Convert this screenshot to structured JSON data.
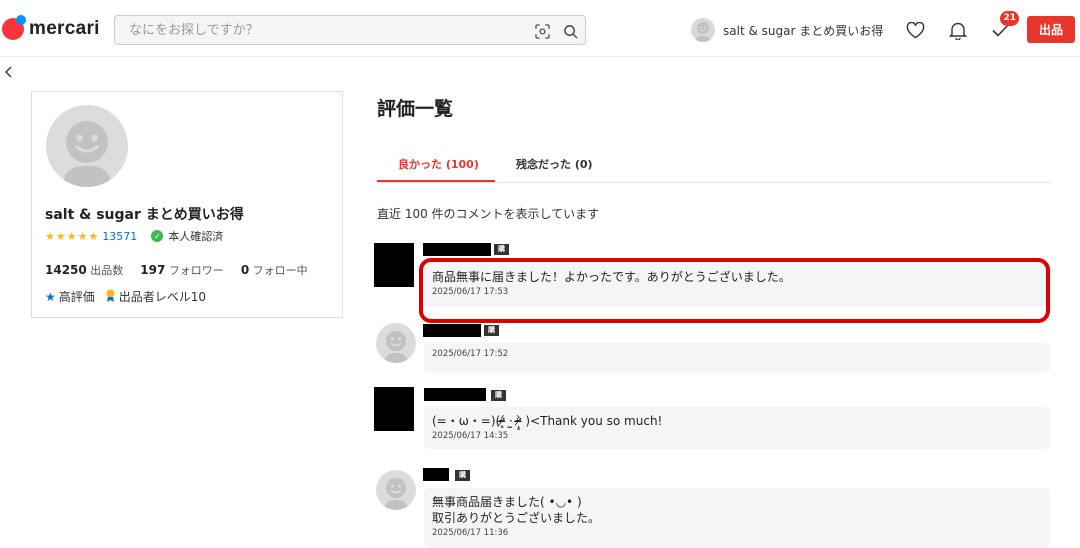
{
  "header": {
    "logo_text": "mercari",
    "search_placeholder": "なにをお探しですか？",
    "user_name": "salt & sugar まとめ買いお得",
    "todo_count": "21",
    "sell_label": "出品"
  },
  "profile": {
    "name": "salt & sugar まとめ買いお得",
    "stars": "★★★★★",
    "review_count": "13571",
    "verified_label": "本人確認済",
    "listings_count": "14250",
    "listings_label": "出品数",
    "followers_count": "197",
    "followers_label": "フォロワー",
    "following_count": "0",
    "following_label": "フォロー中",
    "badge_high_rating": "高評価",
    "badge_seller_level": "出品者レベル10"
  },
  "main": {
    "title": "評価一覧",
    "tabs": [
      {
        "label": "良かった (100)",
        "active": true
      },
      {
        "label": "残念だった (0)",
        "active": false
      }
    ],
    "summary": "直近 100 件のコメントを表示しています",
    "buyer_tag": "購入者",
    "reviews": [
      {
        "text": "商品無事に届きました！よかったです。ありがとうございました。",
        "date": "2025/06/17 17:53"
      },
      {
        "text": "",
        "date": "2025/06/17 17:52"
      },
      {
        "text": "(=・ω・=)(ᵒ̴̶̷̥́ ·̫ ᵒ̴̶̷̣̥̀ )<Thank you so much!",
        "date": "2025/06/17 14:35"
      },
      {
        "text": "無事商品届きました( •◡• )",
        "text2": "取引ありがとうございました。",
        "date": "2025/06/17 11:36"
      }
    ]
  },
  "colors": {
    "accent": "#ea352d",
    "link": "#0073cc",
    "star": "#ffb818",
    "verified": "#3cba54"
  }
}
